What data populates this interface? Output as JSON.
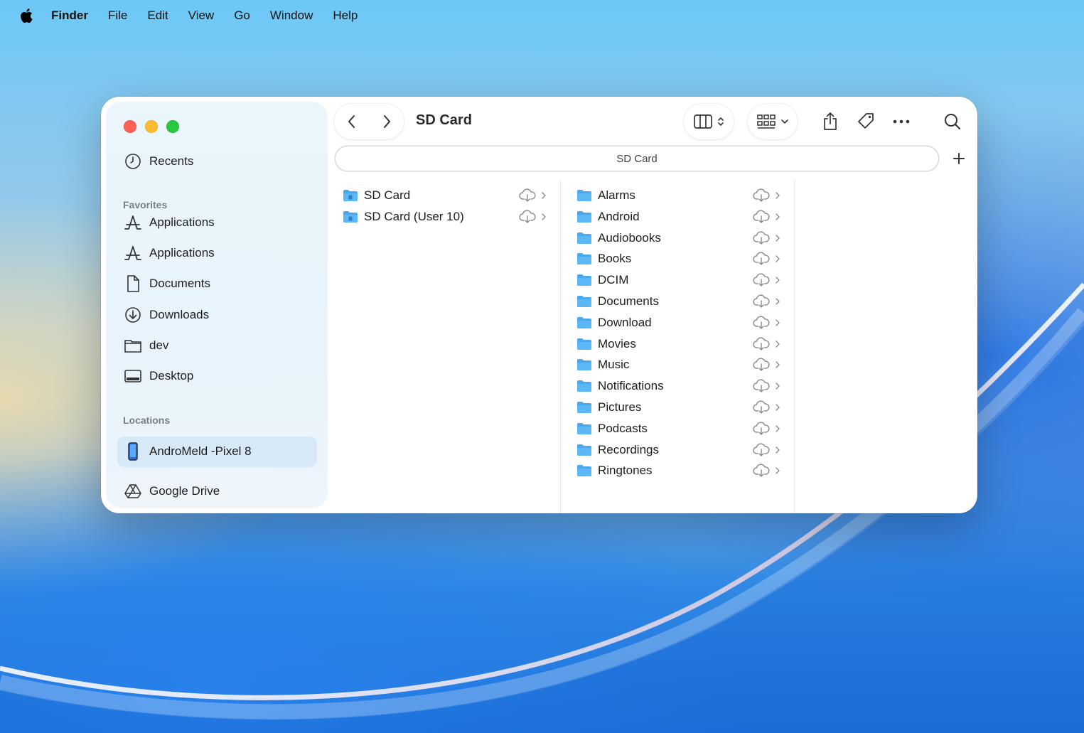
{
  "menubar": {
    "items": [
      "Finder",
      "File",
      "Edit",
      "View",
      "Go",
      "Window",
      "Help"
    ]
  },
  "window": {
    "title": "SD Card",
    "path_label": "SD Card"
  },
  "sidebar": {
    "recents": "Recents",
    "favorites_header": "Favorites",
    "favorites": [
      {
        "label": "Applications",
        "icon": "applications-icon"
      },
      {
        "label": "Applications",
        "icon": "applications-icon"
      },
      {
        "label": "Documents",
        "icon": "document-icon"
      },
      {
        "label": "Downloads",
        "icon": "download-icon"
      },
      {
        "label": "dev",
        "icon": "folder-icon"
      },
      {
        "label": "Desktop",
        "icon": "desktop-icon"
      }
    ],
    "locations_header": "Locations",
    "locations": [
      {
        "label": "AndroMeld -Pixel 8",
        "icon": "phone-icon",
        "selected": true
      },
      {
        "label": "Google Drive",
        "icon": "google-drive-icon"
      }
    ]
  },
  "column1": {
    "items": [
      "SD Card",
      "SD Card (User 10)"
    ]
  },
  "column2": {
    "items": [
      "Alarms",
      "Android",
      "Audiobooks",
      "Books",
      "DCIM",
      "Documents",
      "Download",
      "Movies",
      "Music",
      "Notifications",
      "Pictures",
      "Podcasts",
      "Recordings",
      "Ringtones"
    ]
  },
  "colors": {
    "accent_folder": "#49a8ee",
    "selected_bg": "#d7e9f7"
  }
}
